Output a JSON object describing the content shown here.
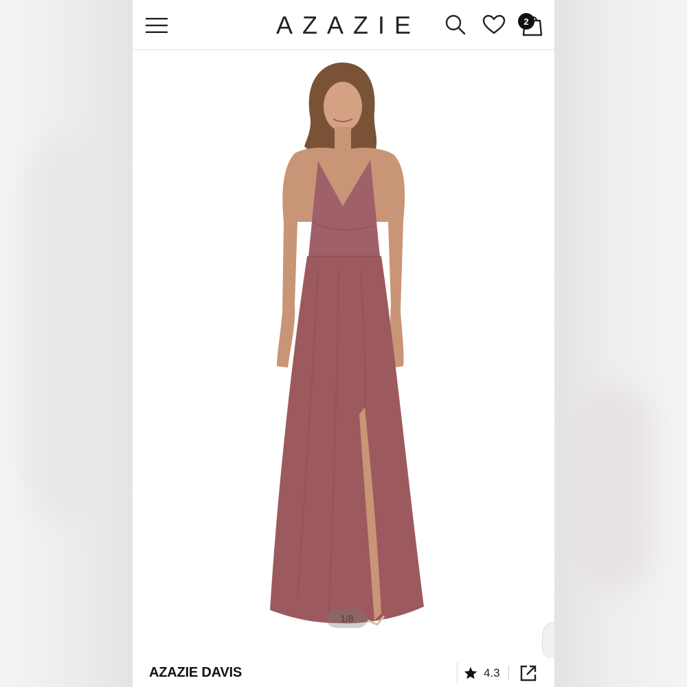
{
  "header": {
    "logo_text": "AZAZIE",
    "cart_count": "2",
    "menu_icon": "hamburger-menu-icon",
    "search_icon": "search-icon",
    "wishlist_icon": "heart-icon",
    "cart_icon": "shopping-bag-icon"
  },
  "gallery": {
    "counter": "1/8",
    "dress_color": "#9c5a5e"
  },
  "product": {
    "name": "AZAZIE DAVIS",
    "rating": "4.3",
    "rating_icon": "star-icon",
    "share_icon": "share-external-icon"
  }
}
